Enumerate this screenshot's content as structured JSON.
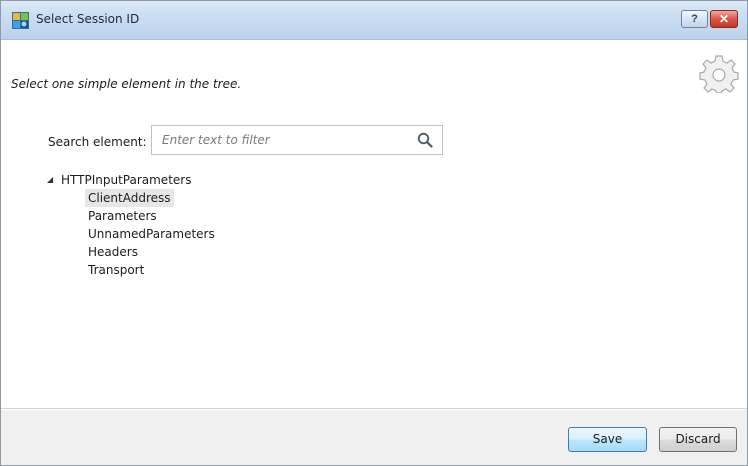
{
  "window": {
    "title": "Select Session ID",
    "help_label": "?",
    "close_label": "✕"
  },
  "instruction": "Select one simple element in the tree.",
  "icons": {
    "app": "app-icon",
    "gear": "gear-icon",
    "search": "search-icon",
    "expander": "expanded-triangle-icon"
  },
  "search": {
    "label": "Search element:",
    "placeholder": "Enter text to filter",
    "value": ""
  },
  "tree": {
    "root": {
      "label": "HTTPInputParameters",
      "expander": "◢"
    },
    "children": [
      {
        "label": "ClientAddress"
      },
      {
        "label": "Parameters"
      },
      {
        "label": "UnnamedParameters"
      },
      {
        "label": "Headers"
      },
      {
        "label": "Transport"
      }
    ],
    "selected": "ClientAddress"
  },
  "buttons": {
    "save": "Save",
    "discard": "Discard"
  },
  "colors": {
    "titlebar": "#c9dcf1",
    "accent_button_border": "#3c7fb1",
    "selection": "#e6e6e6",
    "footer": "#f0f0f0"
  }
}
